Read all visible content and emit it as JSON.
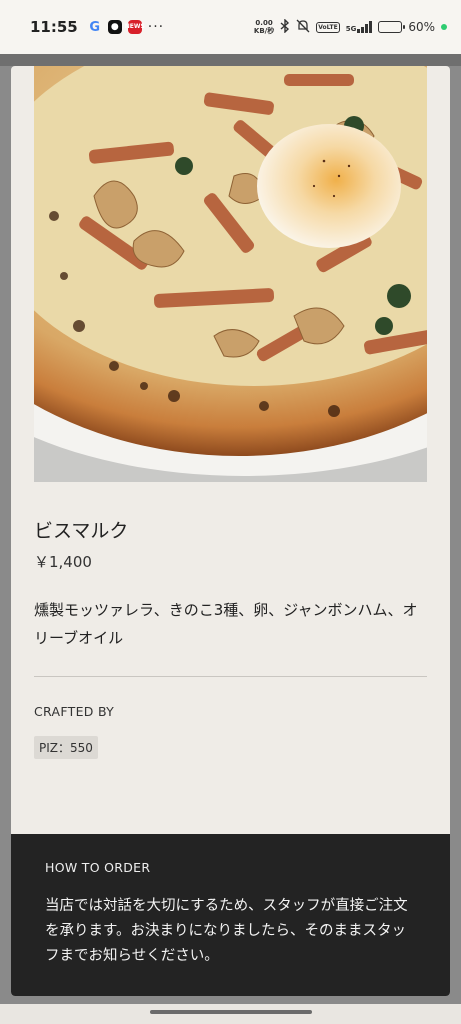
{
  "status_bar": {
    "time": "11:55",
    "app_icons": [
      "G",
      "●",
      "NEWS"
    ],
    "more": "···",
    "net_speed_value": "0.00",
    "net_speed_unit": "KB/秒",
    "volte": "VoLTE",
    "network": "5G",
    "battery_percent": "60%",
    "battery_level": 0.6,
    "battery_color": "#f4b400",
    "dot_color": "#2ecc71"
  },
  "product": {
    "image_icon": "pizza-photo",
    "name": "ビスマルク",
    "price": "￥1,400",
    "description": "燻製モッツァレラ、きのこ3種、卵、ジャンボンハム、オリーブオイル"
  },
  "crafted": {
    "label": "CRAFTED BY",
    "tag": "PIZ：550"
  },
  "order": {
    "title": "HOW TO ORDER",
    "text": "当店では対話を大切にするため、スタッフが直接ご注文を承ります。お決まりになりましたら、そのままスタッフまでお知らせください。"
  },
  "colors": {
    "card_bg": "#efece7",
    "panel_bg": "#232323",
    "backdrop": "#8a8a8a"
  }
}
